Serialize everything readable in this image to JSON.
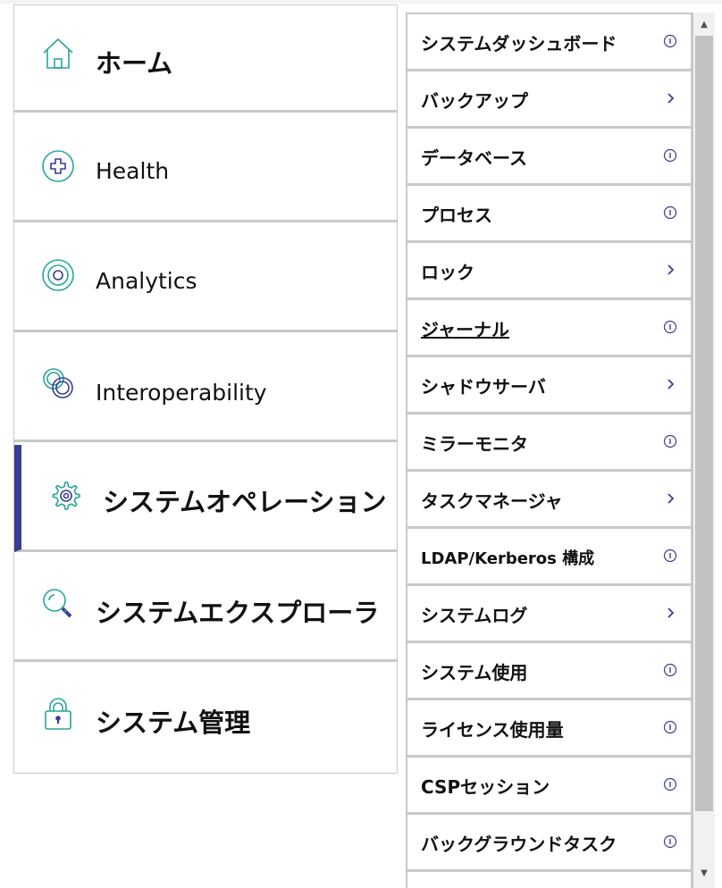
{
  "left_nav": {
    "items": [
      {
        "label": "ホーム",
        "icon": "home-icon",
        "lang": "jp",
        "active": false
      },
      {
        "label": "Health",
        "icon": "health-plus-icon",
        "lang": "en",
        "active": false
      },
      {
        "label": "Analytics",
        "icon": "analytics-target-icon",
        "lang": "en",
        "active": false
      },
      {
        "label": "Interoperability",
        "icon": "interoperability-rings-icon",
        "lang": "en",
        "active": false
      },
      {
        "label": "システムオペレーション",
        "icon": "gear-icon",
        "lang": "jp",
        "active": true
      },
      {
        "label": "システムエクスプローラ",
        "icon": "magnifier-icon",
        "lang": "jp",
        "active": false
      },
      {
        "label": "システム管理",
        "icon": "lock-icon",
        "lang": "jp",
        "active": false
      }
    ]
  },
  "sub_menu": {
    "items": [
      {
        "label": "システムダッシュボード",
        "action": "info"
      },
      {
        "label": "バックアップ",
        "action": "chevron"
      },
      {
        "label": "データベース",
        "action": "info"
      },
      {
        "label": "プロセス",
        "action": "info"
      },
      {
        "label": "ロック",
        "action": "chevron"
      },
      {
        "label": "ジャーナル",
        "action": "info",
        "underlined": true
      },
      {
        "label": "シャドウサーバ",
        "action": "chevron"
      },
      {
        "label": "ミラーモニタ",
        "action": "info"
      },
      {
        "label": "タスクマネージャ",
        "action": "chevron"
      },
      {
        "label": "LDAP/Kerberos 構成",
        "action": "info",
        "small": true
      },
      {
        "label": "システムログ",
        "action": "chevron"
      },
      {
        "label": "システム使用",
        "action": "info"
      },
      {
        "label": "ライセンス使用量",
        "action": "info"
      },
      {
        "label": "CSPセッション",
        "action": "info"
      },
      {
        "label": "バックグラウンドタスク",
        "action": "info"
      }
    ]
  },
  "colors": {
    "accent_teal": "#26a69a",
    "active_bar": "#3a3d94",
    "icon_navy": "#3a3d94",
    "divider": "#c9c9c9"
  }
}
